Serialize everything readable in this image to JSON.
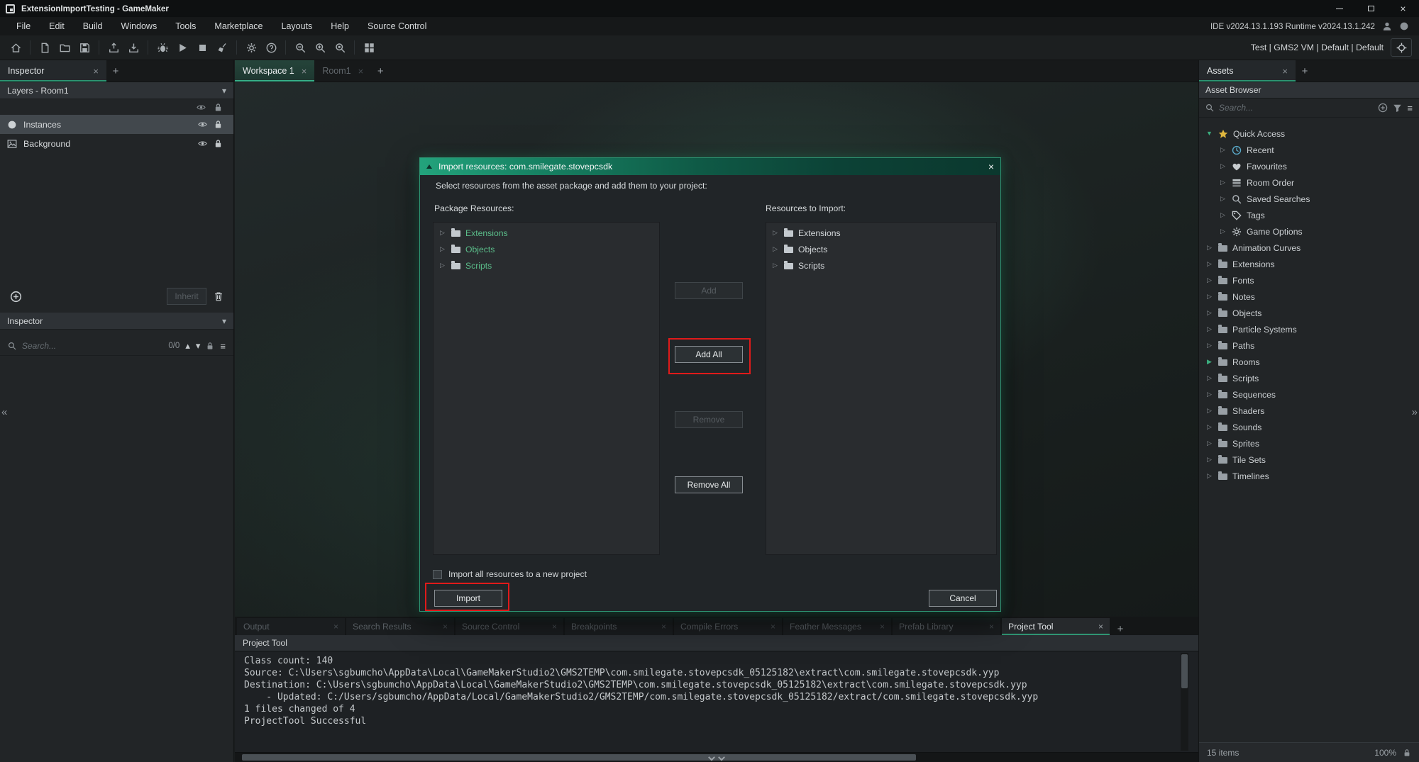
{
  "titlebar": {
    "title": "ExtensionImportTesting - GameMaker"
  },
  "menubar": {
    "items": [
      "File",
      "Edit",
      "Build",
      "Windows",
      "Tools",
      "Marketplace",
      "Layouts",
      "Help",
      "Source Control"
    ],
    "version_info": "IDE v2024.13.1.193  Runtime v2024.13.1.242"
  },
  "toolbar": {
    "target_text": "Test | GMS2 VM | Default | Default"
  },
  "inspector_panel": {
    "tab_label": "Inspector",
    "layers_dropdown": "Layers - Room1",
    "layers": [
      {
        "name": "Instances",
        "icon": "instance-icon",
        "selected": true
      },
      {
        "name": "Background",
        "icon": "background-icon",
        "selected": false
      }
    ],
    "inherit_button": "Inherit",
    "inspector_dropdown": "Inspector",
    "search_placeholder": "Search...",
    "search_count": "0/0"
  },
  "workspace": {
    "tabs": [
      {
        "label": "Workspace 1",
        "active": true
      },
      {
        "label": "Room1",
        "active": false
      }
    ]
  },
  "import_dialog": {
    "title": "Import resources: com.smilegate.stovepcsdk",
    "instruction": "Select resources from the asset package and add them to your project:",
    "package_resources_label": "Package Resources:",
    "resources_to_import_label": "Resources to Import:",
    "package_resources": [
      "Extensions",
      "Objects",
      "Scripts"
    ],
    "resources_to_import": [
      "Extensions",
      "Objects",
      "Scripts"
    ],
    "add_button": "Add",
    "add_all_button": "Add All",
    "remove_button": "Remove",
    "remove_all_button": "Remove All",
    "checkbox_label": "Import all resources to a new project",
    "import_button": "Import",
    "cancel_button": "Cancel"
  },
  "assets_panel": {
    "tab_label": "Assets",
    "header": "Asset Browser",
    "search_placeholder": "Search...",
    "tree": [
      {
        "label": "Quick Access",
        "icon": "star-icon",
        "arrow": "down-green",
        "level": 0
      },
      {
        "label": "Recent",
        "icon": "recent-icon",
        "arrow": "right",
        "level": 1
      },
      {
        "label": "Favourites",
        "icon": "heart-icon",
        "arrow": "right",
        "level": 1
      },
      {
        "label": "Room Order",
        "icon": "room-order-icon",
        "arrow": "right",
        "level": 1
      },
      {
        "label": "Saved Searches",
        "icon": "saved-search-icon",
        "arrow": "right",
        "level": 1
      },
      {
        "label": "Tags",
        "icon": "tag-icon",
        "arrow": "right",
        "level": 1
      },
      {
        "label": "Game Options",
        "icon": "gear-icon",
        "arrow": "right",
        "level": 1
      },
      {
        "label": "Animation Curves",
        "icon": "folder-icon",
        "arrow": "right",
        "level": 0
      },
      {
        "label": "Extensions",
        "icon": "folder-icon",
        "arrow": "right",
        "level": 0
      },
      {
        "label": "Fonts",
        "icon": "folder-icon",
        "arrow": "right",
        "level": 0
      },
      {
        "label": "Notes",
        "icon": "folder-icon",
        "arrow": "right",
        "level": 0
      },
      {
        "label": "Objects",
        "icon": "folder-icon",
        "arrow": "right",
        "level": 0
      },
      {
        "label": "Particle Systems",
        "icon": "folder-icon",
        "arrow": "right",
        "level": 0
      },
      {
        "label": "Paths",
        "icon": "folder-icon",
        "arrow": "right",
        "level": 0
      },
      {
        "label": "Rooms",
        "icon": "folder-icon",
        "arrow": "right-green",
        "level": 0
      },
      {
        "label": "Scripts",
        "icon": "folder-icon",
        "arrow": "right",
        "level": 0
      },
      {
        "label": "Sequences",
        "icon": "folder-icon",
        "arrow": "right",
        "level": 0
      },
      {
        "label": "Shaders",
        "icon": "folder-icon",
        "arrow": "right",
        "level": 0
      },
      {
        "label": "Sounds",
        "icon": "folder-icon",
        "arrow": "right",
        "level": 0
      },
      {
        "label": "Sprites",
        "icon": "folder-icon",
        "arrow": "right",
        "level": 0
      },
      {
        "label": "Tile Sets",
        "icon": "folder-icon",
        "arrow": "right",
        "level": 0
      },
      {
        "label": "Timelines",
        "icon": "folder-icon",
        "arrow": "right",
        "level": 0
      }
    ],
    "footer_items": "15 items",
    "footer_zoom": "100%"
  },
  "output_panel": {
    "tabs": [
      {
        "label": "Output",
        "active": false
      },
      {
        "label": "Search Results",
        "active": false
      },
      {
        "label": "Source Control",
        "active": false
      },
      {
        "label": "Breakpoints",
        "active": false
      },
      {
        "label": "Compile Errors",
        "active": false
      },
      {
        "label": "Feather Messages",
        "active": false
      },
      {
        "label": "Prefab Library",
        "active": false
      },
      {
        "label": "Project Tool",
        "active": true
      }
    ],
    "header": "Project Tool",
    "log_lines": [
      "Class count: 140",
      "Source: C:\\Users\\sgbumcho\\AppData\\Local\\GameMakerStudio2\\GMS2TEMP\\com.smilegate.stovepcsdk_05125182\\extract\\com.smilegate.stovepcsdk.yyp",
      "Destination: C:\\Users\\sgbumcho\\AppData\\Local\\GameMakerStudio2\\GMS2TEMP\\com.smilegate.stovepcsdk_05125182\\extract\\com.smilegate.stovepcsdk.yyp",
      "    - Updated: C:/Users/sgbumcho/AppData/Local/GameMakerStudio2/GMS2TEMP/com.smilegate.stovepcsdk_05125182/extract/com.smilegate.stovepcsdk.yyp",
      "1 files changed of 4",
      "ProjectTool Successful"
    ]
  },
  "colors": {
    "accent_teal": "#1f8f6e",
    "tree_item_green": "#5bbd8a",
    "highlight_red": "#e01a1a"
  }
}
